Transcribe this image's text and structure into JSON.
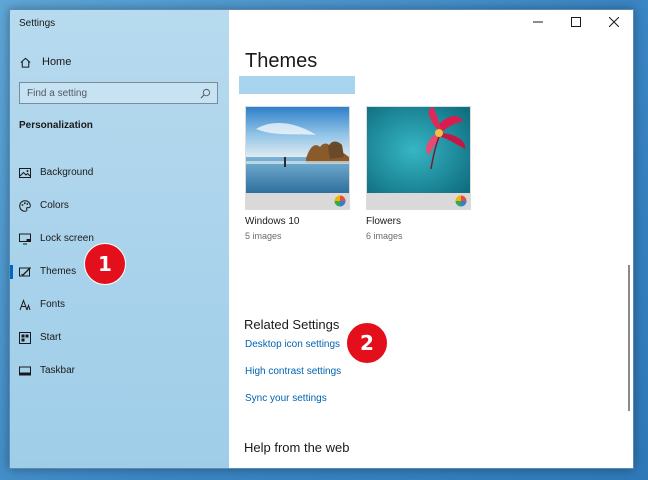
{
  "window": {
    "title": "Settings"
  },
  "sidebar": {
    "home_label": "Home",
    "search_placeholder": "Find a setting",
    "section_title": "Personalization",
    "items": [
      {
        "label": "Background",
        "icon": "picture-icon"
      },
      {
        "label": "Colors",
        "icon": "palette-icon"
      },
      {
        "label": "Lock screen",
        "icon": "monitor-lock-icon"
      },
      {
        "label": "Themes",
        "icon": "themes-icon",
        "active": true
      },
      {
        "label": "Fonts",
        "icon": "font-icon"
      },
      {
        "label": "Start",
        "icon": "start-icon"
      },
      {
        "label": "Taskbar",
        "icon": "taskbar-icon"
      }
    ]
  },
  "main": {
    "title": "Themes",
    "themes": [
      {
        "name": "Windows 10",
        "count": "5 images"
      },
      {
        "name": "Flowers",
        "count": "6 images"
      }
    ],
    "related_title": "Related Settings",
    "links": [
      "Desktop icon settings",
      "High contrast settings",
      "Sync your settings"
    ],
    "help_title": "Help from the web"
  },
  "annotations": [
    "1",
    "2"
  ],
  "colors": {
    "accent": "#0067c0",
    "link": "#0063b1",
    "badge": "#e3101c",
    "sidebar_bg": "#b7daee",
    "highlight": "#a8d4f0"
  }
}
